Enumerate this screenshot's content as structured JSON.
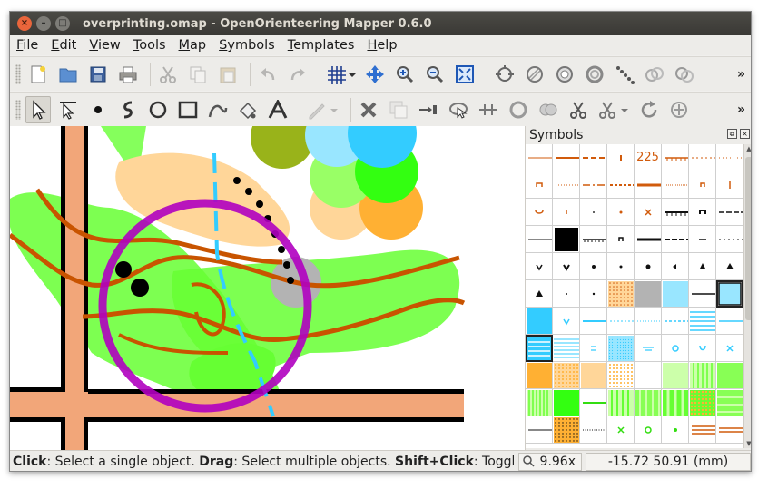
{
  "window": {
    "title": "overprinting.omap - OpenOrienteering Mapper 0.6.0",
    "close_glyph": "×",
    "minimize_glyph": "–",
    "maximize_glyph": "□"
  },
  "menubar": {
    "items": [
      {
        "first": "F",
        "rest": "ile"
      },
      {
        "first": "E",
        "rest": "dit"
      },
      {
        "first": "V",
        "rest": "iew"
      },
      {
        "first": "T",
        "rest": "ools"
      },
      {
        "first": "M",
        "rest": "ap"
      },
      {
        "first": "S",
        "rest": "ymbols"
      },
      {
        "first": "T",
        "rest": "emplates"
      },
      {
        "first": "H",
        "rest": "elp"
      }
    ]
  },
  "toolbar_main": {
    "icons": [
      "new-file-icon",
      "open-folder-icon",
      "save-icon",
      "print-icon",
      "cut-icon",
      "copy-icon",
      "paste-icon",
      "undo-icon",
      "redo-icon",
      "grid-icon",
      "pan-icon",
      "zoom-in-icon",
      "zoom-out-icon",
      "show-all-icon",
      "tag-editor-icon",
      "hatch-icon",
      "symbol-visibility-icon",
      "overprint-icon",
      "baseline-view-icon",
      "hide-all-templates-icon",
      "templates-icon"
    ],
    "more": "»"
  },
  "toolbar_edit": {
    "icons": [
      "edit-objects-icon",
      "edit-line-icon",
      "draw-point-icon",
      "draw-path-icon",
      "draw-circle-icon",
      "draw-rectangle-icon",
      "draw-freehand-icon",
      "fill-icon",
      "write-text-icon",
      "pencil-icon",
      "delete-icon",
      "duplicate-icon",
      "switch-symbol-icon",
      "fill-border-icon",
      "switch-dashes-icon",
      "connect-paths-icon",
      "boolean-union-icon",
      "cut-tool-icon",
      "cut-hole-icon",
      "rotate-icon",
      "scale-icon"
    ],
    "more": "»"
  },
  "symbols_panel": {
    "title": "Symbols",
    "float_glyph": "⧉",
    "close_glyph": "×",
    "label_225": "225",
    "accent_colors": {
      "brown": "#d15b0c",
      "blue": "#33ccff",
      "green": "#66ff33",
      "orange": "#ffb033",
      "gray": "#b3b3b3"
    }
  },
  "statusbar": {
    "click_key": "Click",
    "click_text": ": Select a single object. ",
    "drag_key": "Drag",
    "drag_text": ": Select multiple objects. ",
    "shift_key": "Shift+Click",
    "shift_text": ": Toggle sele",
    "zoom": "9.96x",
    "coordinates": "-15.72 50.91 (mm)"
  }
}
